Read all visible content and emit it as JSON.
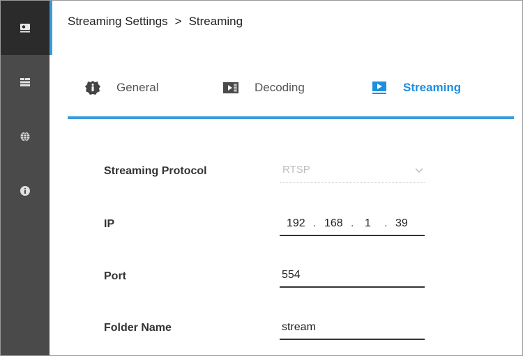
{
  "sidebar": {
    "items": [
      {
        "icon": "streaming-display-icon",
        "active": true
      },
      {
        "icon": "network-panel-icon",
        "active": false
      },
      {
        "icon": "globe-icon",
        "active": false
      },
      {
        "icon": "info-icon",
        "active": false
      }
    ]
  },
  "breadcrumb": {
    "parent": "Streaming Settings",
    "separator": ">",
    "current": "Streaming"
  },
  "tabs": [
    {
      "label": "General",
      "icon": "info-shield-icon",
      "active": false
    },
    {
      "label": "Decoding",
      "icon": "video-film-icon",
      "active": false
    },
    {
      "label": "Streaming",
      "icon": "play-monitor-icon",
      "active": true
    }
  ],
  "form": {
    "protocol": {
      "label": "Streaming Protocol",
      "value": "RTSP"
    },
    "ip": {
      "label": "IP",
      "octets": [
        "192",
        "168",
        "1",
        "39"
      ],
      "dot": "."
    },
    "port": {
      "label": "Port",
      "value": "554"
    },
    "folder": {
      "label": "Folder Name",
      "value": "stream"
    }
  },
  "colors": {
    "accent": "#1e8fe0",
    "sidebar": "#4a4a4a",
    "sidebar_active": "#2b2b2b",
    "underline": "#3a9bdc"
  }
}
